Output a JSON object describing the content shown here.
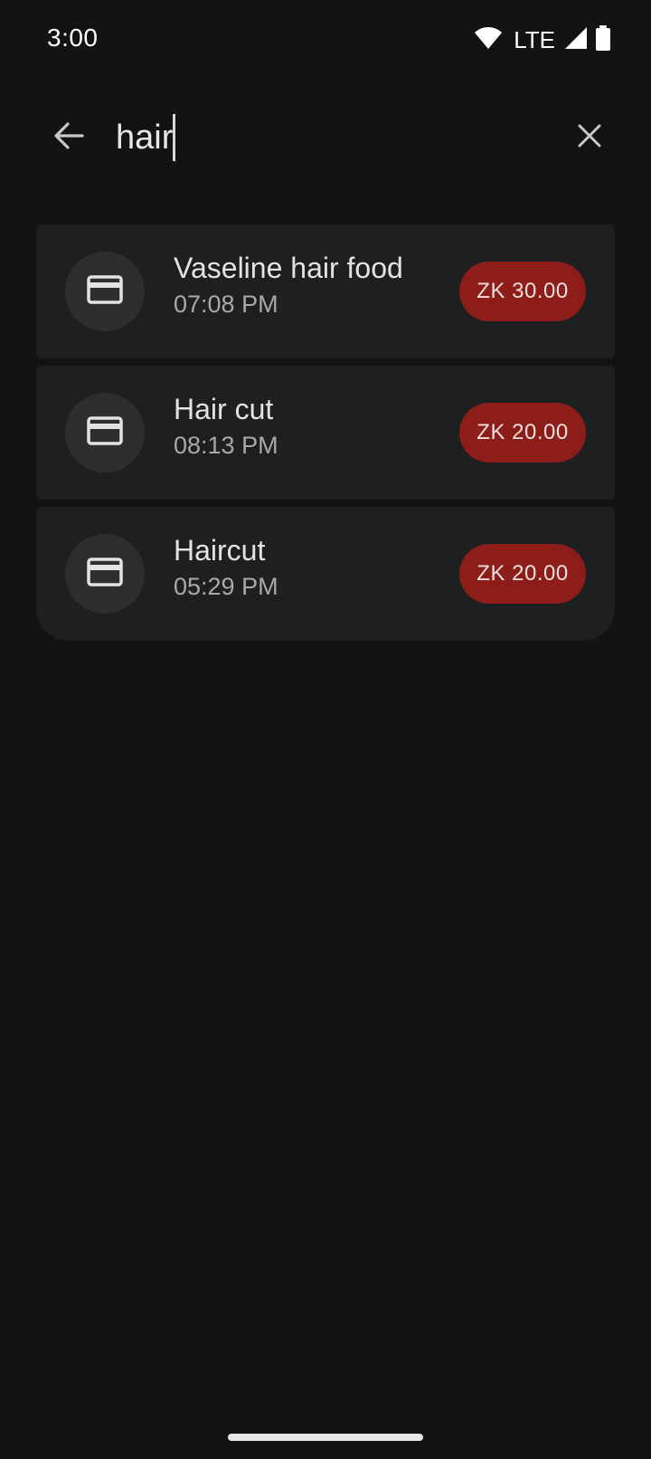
{
  "status_bar": {
    "time": "3:00",
    "network": "LTE",
    "icons": [
      "wifi-icon",
      "cell-signal-icon",
      "battery-icon"
    ]
  },
  "search": {
    "query": "hair",
    "back_icon": "arrow-back-icon",
    "clear_icon": "close-icon"
  },
  "results": [
    {
      "title": "Vaseline hair food",
      "time": "07:08 PM",
      "amount": "ZK 30.00",
      "icon": "credit-card-icon"
    },
    {
      "title": "Hair cut",
      "time": "08:13 PM",
      "amount": "ZK 20.00",
      "icon": "credit-card-icon"
    },
    {
      "title": "Haircut",
      "time": "05:29 PM",
      "amount": "ZK 20.00",
      "icon": "credit-card-icon"
    }
  ],
  "colors": {
    "background": "#121315",
    "card": "#1e1f20",
    "expense_badge": "#8c1d18"
  }
}
